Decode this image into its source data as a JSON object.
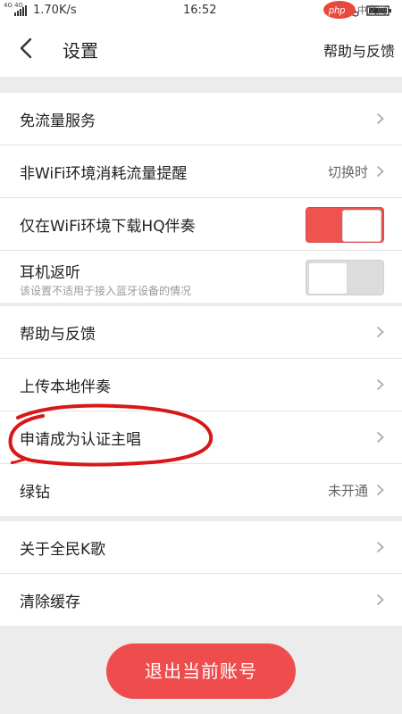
{
  "status_bar": {
    "network_type": "4G 4G",
    "speed": "1.70K/s",
    "time": "16:52"
  },
  "header": {
    "title": "设置",
    "help_feedback": "帮助与反馈"
  },
  "groups": [
    {
      "items": [
        {
          "label": "免流量服务"
        },
        {
          "label": "非WiFi环境消耗流量提醒",
          "value": "切换时"
        },
        {
          "label": "仅在WiFi环境下载HQ伴奏",
          "toggle": true
        },
        {
          "label": "耳机返听",
          "subtitle": "该设置不适用于接入蓝牙设备的情况",
          "toggle": false
        }
      ]
    },
    {
      "items": [
        {
          "label": "帮助与反馈"
        },
        {
          "label": "上传本地伴奏"
        },
        {
          "label": "申请成为认证主唱"
        },
        {
          "label": "绿钻",
          "value": "未开通"
        }
      ]
    },
    {
      "items": [
        {
          "label": "关于全民K歌"
        },
        {
          "label": "清除缓存"
        }
      ]
    }
  ],
  "logout_button": "退出当前账号",
  "colors": {
    "accent": "#ef4d4d",
    "annotation": "#d81818",
    "background": "#ececec"
  }
}
